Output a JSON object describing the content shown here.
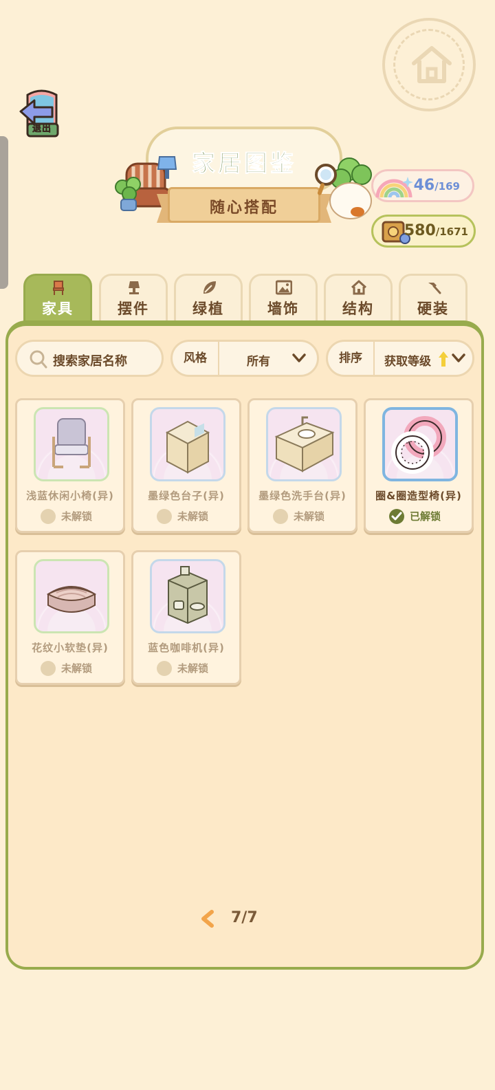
{
  "header": {
    "exit_label": "退出",
    "title": "家居图鉴",
    "subtitle": "随心搭配"
  },
  "counters": {
    "rainbow": {
      "count": "46",
      "total": "/169"
    },
    "coins": {
      "count": "580",
      "total": "/1671"
    }
  },
  "tabs": [
    {
      "label": "家具",
      "icon": "chair-icon",
      "active": true
    },
    {
      "label": "摆件",
      "icon": "lamp-icon",
      "active": false
    },
    {
      "label": "绿植",
      "icon": "leaf-icon",
      "active": false
    },
    {
      "label": "墙饰",
      "icon": "picture-icon",
      "active": false
    },
    {
      "label": "结构",
      "icon": "house-icon",
      "active": false
    },
    {
      "label": "硬装",
      "icon": "hammer-icon",
      "active": false
    }
  ],
  "filters": {
    "search_placeholder": "搜索家居名称",
    "style_label": "风格",
    "style_value": "所有",
    "sort_label": "排序",
    "sort_value": "获取等级"
  },
  "items": [
    {
      "name": "浅蓝休闲小椅(异)",
      "status": "未解锁",
      "unlocked": false
    },
    {
      "name": "墨绿色台子(异)",
      "status": "未解锁",
      "unlocked": false
    },
    {
      "name": "墨绿色洗手台(异)",
      "status": "未解锁",
      "unlocked": false
    },
    {
      "name": "圈&圈造型椅(异)",
      "status": "已解锁",
      "unlocked": true
    },
    {
      "name": "花纹小软垫(异)",
      "status": "未解锁",
      "unlocked": false
    },
    {
      "name": "蓝色咖啡机(异)",
      "status": "未解锁",
      "unlocked": false
    }
  ],
  "pager": {
    "text": "7/7"
  },
  "colors": {
    "accent_green": "#a7b95a",
    "panel_bg": "#fde9c8",
    "page_bg": "#fdf0d6",
    "unlocked_green": "#6d7b34"
  }
}
